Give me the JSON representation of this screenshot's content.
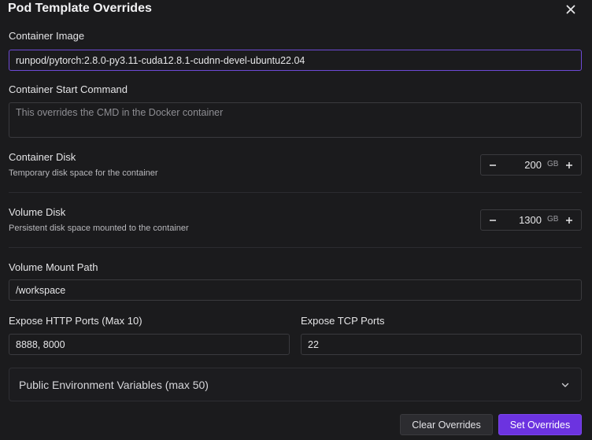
{
  "dialog": {
    "title": "Pod Template Overrides"
  },
  "container_image": {
    "label": "Container Image",
    "value": "runpod/pytorch:2.8.0-py3.11-cuda12.8.1-cudnn-devel-ubuntu22.04"
  },
  "start_command": {
    "label": "Container Start Command",
    "placeholder": "This overrides the CMD in the Docker container",
    "value": ""
  },
  "container_disk": {
    "label": "Container Disk",
    "description": "Temporary disk space for the container",
    "value": "200",
    "unit": "GB"
  },
  "volume_disk": {
    "label": "Volume Disk",
    "description": "Persistent disk space mounted to the container",
    "value": "1300",
    "unit": "GB"
  },
  "volume_mount": {
    "label": "Volume Mount Path",
    "value": "/workspace"
  },
  "http_ports": {
    "label": "Expose HTTP Ports (Max 10)",
    "value": "8888, 8000"
  },
  "tcp_ports": {
    "label": "Expose TCP Ports",
    "value": "22"
  },
  "env_vars": {
    "label": "Public Environment Variables (max 50)"
  },
  "actions": {
    "clear_label": "Clear Overrides",
    "set_label": "Set Overrides"
  },
  "colors": {
    "background": "#1b1b1d",
    "accent": "#6c33e0",
    "focus_border": "#6e4ad6"
  },
  "icons": {
    "close": "close-icon",
    "minus": "minus-icon",
    "plus": "plus-icon",
    "chevron": "chevron-down-icon"
  }
}
